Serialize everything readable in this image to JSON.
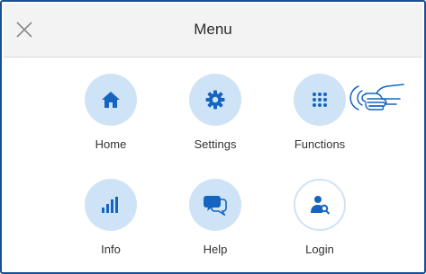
{
  "header": {
    "title": "Menu",
    "close_icon": "close-icon"
  },
  "menu": {
    "items": [
      {
        "label": "Home",
        "icon": "home-icon"
      },
      {
        "label": "Settings",
        "icon": "gear-icon"
      },
      {
        "label": "Functions",
        "icon": "grid-icon"
      },
      {
        "label": "Info",
        "icon": "bar-chart-icon"
      },
      {
        "label": "Help",
        "icon": "chat-bubbles-icon"
      },
      {
        "label": "Login",
        "icon": "user-key-icon"
      }
    ]
  },
  "colors": {
    "frame_border": "#1a4f93",
    "icon_blue": "#1565c0",
    "circle_bg": "#cfe3f7",
    "header_bg": "#f3f3f3"
  }
}
